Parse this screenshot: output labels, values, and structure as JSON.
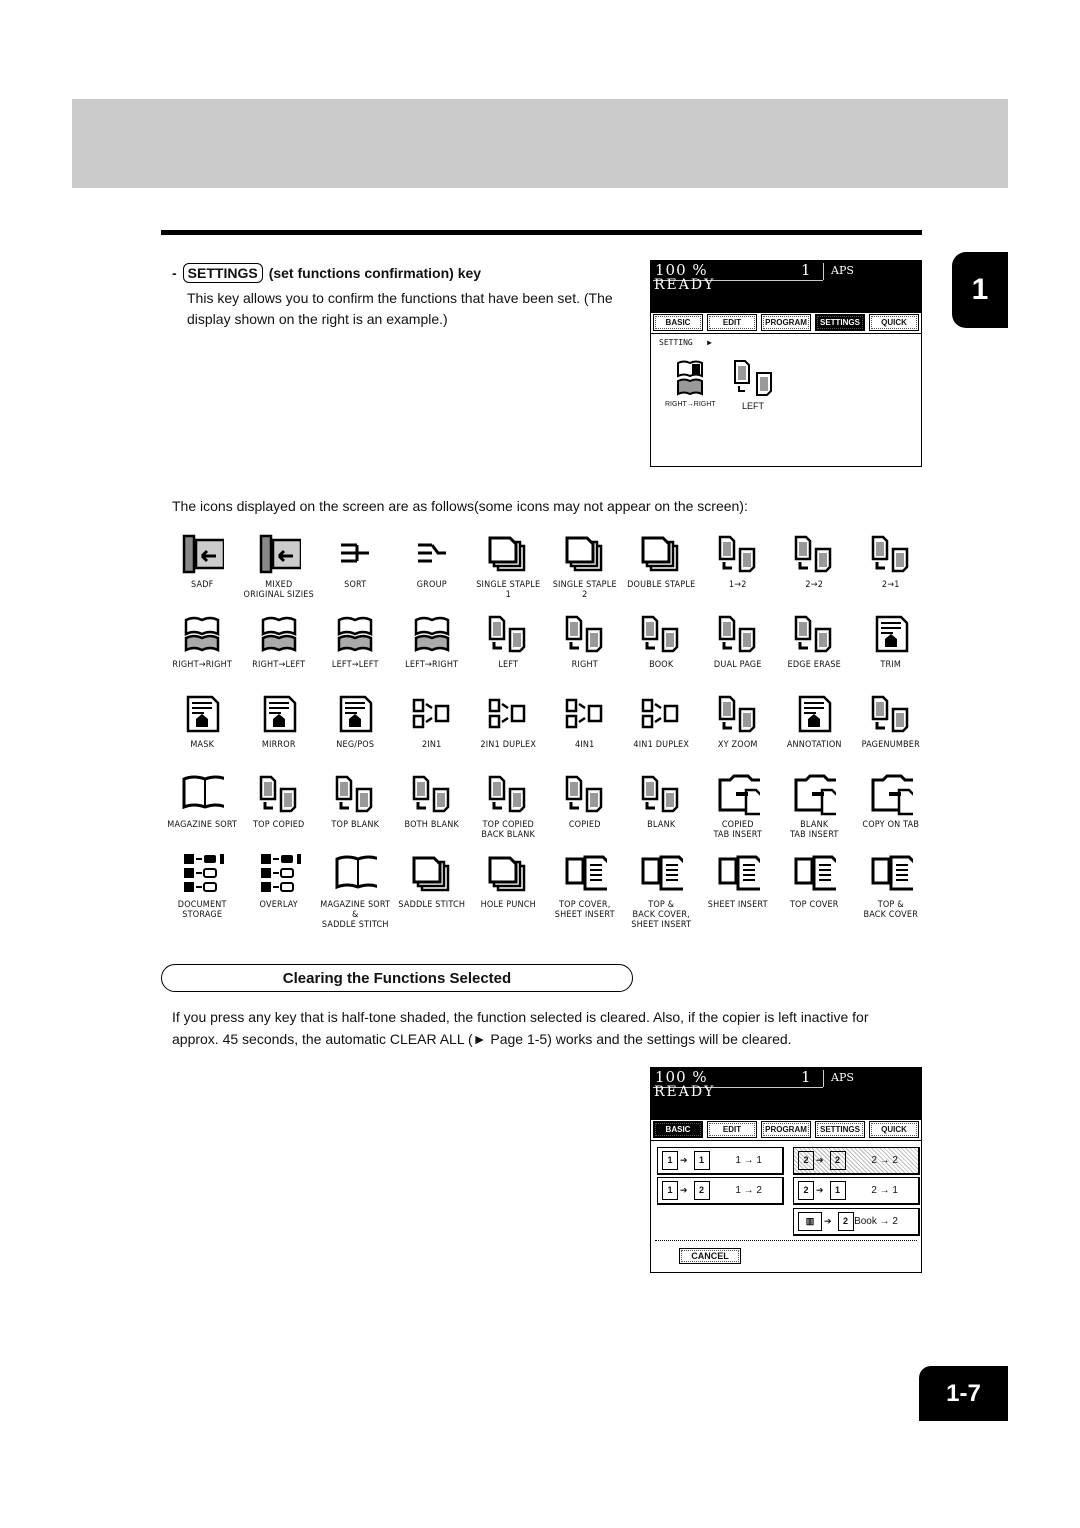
{
  "chapter_tab": "1",
  "page_number": "1-7",
  "settings_key": {
    "bullet": "-",
    "key_label": "SETTINGS",
    "title": "(set functions confirmation) key",
    "description": "This key allows you to confirm the functions that have been set. (The display shown on the right is an example.)"
  },
  "panel_settings": {
    "zoom": "100  %",
    "copies": "1",
    "aps": "APS",
    "status": "READY",
    "tabs": [
      "BASIC",
      "EDIT",
      "PROGRAM",
      "SETTINGS",
      "QUICK"
    ],
    "active_tab": "SETTINGS",
    "setting_label": "SETTING",
    "icons": [
      {
        "label": "RIGHT→RIGHT",
        "icon": "book-right-right-icon"
      },
      {
        "label": "LEFT",
        "icon": "duplex-left-icon"
      }
    ]
  },
  "icons_intro": "The icons displayed on the screen are as follows(some icons may not appear on the screen):",
  "icon_rows": [
    [
      {
        "label": "SADF",
        "icon": "sadf-icon"
      },
      {
        "label": "MIXED\nORIGINAL SIZIES",
        "icon": "mixed-original-sizes-icon"
      },
      {
        "label": "SORT",
        "icon": "sort-icon"
      },
      {
        "label": "GROUP",
        "icon": "group-icon"
      },
      {
        "label": "SINGLE STAPLE\n1",
        "icon": "single-staple-1-icon"
      },
      {
        "label": "SINGLE STAPLE\n2",
        "icon": "single-staple-2-icon"
      },
      {
        "label": "DOUBLE STAPLE",
        "icon": "double-staple-icon"
      },
      {
        "label": "1→2",
        "icon": "duplex-1-2-icon"
      },
      {
        "label": "2→2",
        "icon": "duplex-2-2-icon"
      },
      {
        "label": "2→1",
        "icon": "duplex-2-1-icon"
      }
    ],
    [
      {
        "label": "RIGHT→RIGHT",
        "icon": "book-right-right-icon"
      },
      {
        "label": "RIGHT→LEFT",
        "icon": "book-right-left-icon"
      },
      {
        "label": "LEFT→LEFT",
        "icon": "book-left-left-icon"
      },
      {
        "label": "LEFT→RIGHT",
        "icon": "book-left-right-icon"
      },
      {
        "label": "LEFT",
        "icon": "binding-left-icon"
      },
      {
        "label": "RIGHT",
        "icon": "binding-right-icon"
      },
      {
        "label": "BOOK",
        "icon": "book-icon"
      },
      {
        "label": "DUAL PAGE",
        "icon": "dual-page-icon"
      },
      {
        "label": "EDGE ERASE",
        "icon": "edge-erase-icon"
      },
      {
        "label": "TRIM",
        "icon": "trim-icon"
      }
    ],
    [
      {
        "label": "MASK",
        "icon": "mask-icon"
      },
      {
        "label": "MIRROR",
        "icon": "mirror-icon"
      },
      {
        "label": "NEG/POS",
        "icon": "neg-pos-icon"
      },
      {
        "label": "2IN1",
        "icon": "2in1-icon"
      },
      {
        "label": "2IN1 DUPLEX",
        "icon": "2in1-duplex-icon"
      },
      {
        "label": "4IN1",
        "icon": "4in1-icon"
      },
      {
        "label": "4IN1 DUPLEX",
        "icon": "4in1-duplex-icon"
      },
      {
        "label": "XY ZOOM",
        "icon": "xy-zoom-icon"
      },
      {
        "label": "ANNOTATION",
        "icon": "annotation-icon"
      },
      {
        "label": "PAGENUMBER",
        "icon": "page-number-icon"
      }
    ],
    [
      {
        "label": "MAGAZINE SORT",
        "icon": "magazine-sort-icon"
      },
      {
        "label": "TOP COPIED",
        "icon": "top-copied-icon"
      },
      {
        "label": "TOP BLANK",
        "icon": "top-blank-icon"
      },
      {
        "label": "BOTH BLANK",
        "icon": "both-blank-icon"
      },
      {
        "label": "TOP COPIED\nBACK BLANK",
        "icon": "top-copied-back-blank-icon"
      },
      {
        "label": "COPIED",
        "icon": "copied-icon"
      },
      {
        "label": "BLANK",
        "icon": "blank-icon"
      },
      {
        "label": "COPIED\nTAB INSERT",
        "icon": "copied-tab-insert-icon"
      },
      {
        "label": "BLANK\nTAB INSERT",
        "icon": "blank-tab-insert-icon"
      },
      {
        "label": "COPY ON TAB",
        "icon": "copy-on-tab-icon"
      }
    ],
    [
      {
        "label": "DOCUMENT\nSTORAGE",
        "icon": "document-storage-icon"
      },
      {
        "label": "OVERLAY",
        "icon": "overlay-icon"
      },
      {
        "label": "MAGAZINE SORT\n&\nSADDLE STITCH",
        "icon": "magazine-sort-saddle-stitch-icon"
      },
      {
        "label": "SADDLE STITCH",
        "icon": "saddle-stitch-icon"
      },
      {
        "label": "HOLE PUNCH",
        "icon": "hole-punch-icon"
      },
      {
        "label": "TOP COVER,\nSHEET INSERT",
        "icon": "top-cover-sheet-insert-icon"
      },
      {
        "label": "TOP &\nBACK COVER,\nSHEET INSERT",
        "icon": "top-back-cover-sheet-insert-icon"
      },
      {
        "label": "SHEET INSERT",
        "icon": "sheet-insert-icon"
      },
      {
        "label": "TOP COVER",
        "icon": "top-cover-icon"
      },
      {
        "label": "TOP &\nBACK COVER",
        "icon": "top-back-cover-icon"
      }
    ]
  ],
  "section": {
    "title": "Clearing the Functions Selected",
    "body": "If you press any key that is half-tone shaded, the function selected is cleared. Also, if the copier is left inactive for approx. 45 seconds, the automatic CLEAR ALL (► Page 1-5) works and the settings will be cleared."
  },
  "panel_basic": {
    "zoom": "100  %",
    "copies": "1",
    "aps": "APS",
    "status": "READY",
    "tabs": [
      "BASIC",
      "EDIT",
      "PROGRAM",
      "SETTINGS",
      "QUICK"
    ],
    "active_tab": "BASIC",
    "modes": [
      {
        "label": "1 → 1",
        "from": "1",
        "to": "1",
        "selected": false
      },
      {
        "label": "2 → 2",
        "from": "2",
        "to": "2",
        "selected": true
      },
      {
        "label": "1 → 2",
        "from": "1",
        "to": "2",
        "selected": false
      },
      {
        "label": "2 → 1",
        "from": "2",
        "to": "1",
        "selected": false
      },
      {
        "label": "Book → 2",
        "from": "Book",
        "to": "2",
        "selected": false
      }
    ],
    "cancel_label": "CANCEL"
  }
}
